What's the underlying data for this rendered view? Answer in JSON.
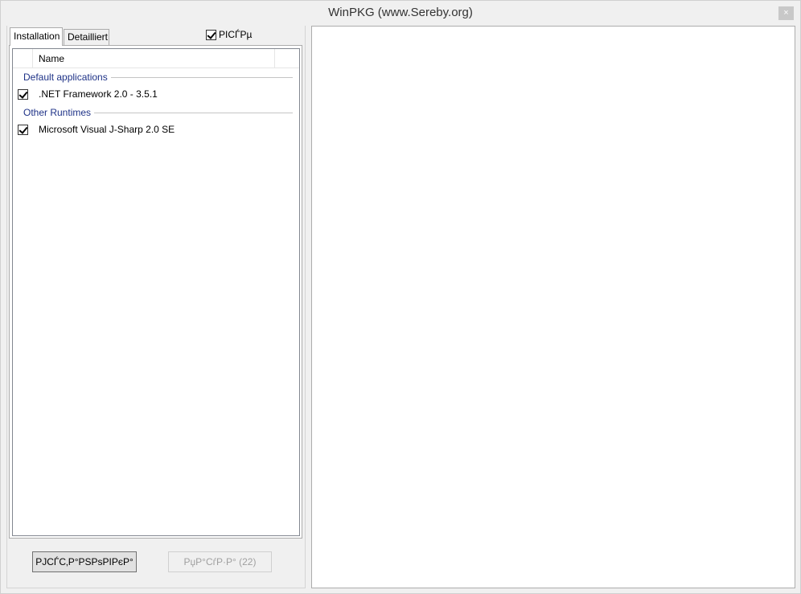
{
  "window": {
    "title": "WinPKG (www.Sereby.org)",
    "close_glyph": "×"
  },
  "tabs": [
    {
      "label": "Installation",
      "active": true
    },
    {
      "label": "Detailliert",
      "active": false
    }
  ],
  "top_checkbox": {
    "label": "PICЃPµ",
    "checked": true
  },
  "list": {
    "column_header": "Name",
    "groups": [
      {
        "title": "Default applications",
        "items": [
          {
            "label": ".NET Framework 2.0 - 3.5.1",
            "checked": true
          }
        ]
      },
      {
        "title": "Other Runtimes",
        "items": [
          {
            "label": "Microsoft Visual J-Sharp 2.0 SE",
            "checked": true
          }
        ]
      }
    ]
  },
  "buttons": {
    "primary_label": "PJCЃC‚P°PSPsPIPєP°",
    "secondary_label": "PџP°CѓP·P° (22)"
  }
}
